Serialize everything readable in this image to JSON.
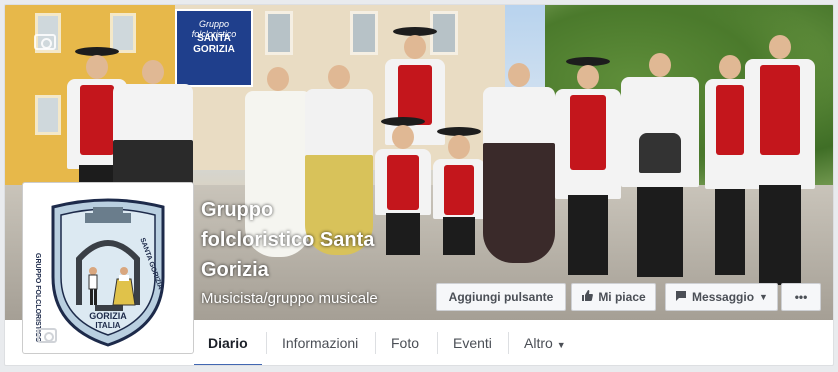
{
  "page": {
    "name_line1": "Gruppo",
    "name_line2": "folcloristico Santa",
    "name_line3": "Gorizia",
    "category": "Musicista/gruppo musicale"
  },
  "cover": {
    "banner_line1": "Gruppo folcloristico",
    "banner_line2": "SANTA GORIZIA"
  },
  "logo": {
    "left_arc_text": "GRUPPO FOLCLORISTICO",
    "right_arc_text": "SANTA GORIZIA",
    "bottom_line1": "GORIZIA",
    "bottom_line2": "ITALIA"
  },
  "actions": {
    "add_button": "Aggiungi pulsante",
    "like_button": "Mi piace",
    "message_button": "Messaggio",
    "more_button": "•••"
  },
  "tabs": [
    {
      "label": "Diario",
      "active": true
    },
    {
      "label": "Informazioni"
    },
    {
      "label": "Foto"
    },
    {
      "label": "Eventi"
    },
    {
      "label": "Altro"
    }
  ],
  "colors": {
    "accent": "#4267b2",
    "vest_red": "#c4161c"
  },
  "icons": [
    "camera-icon",
    "thumbs-up-icon",
    "message-icon",
    "caret-down-icon"
  ]
}
